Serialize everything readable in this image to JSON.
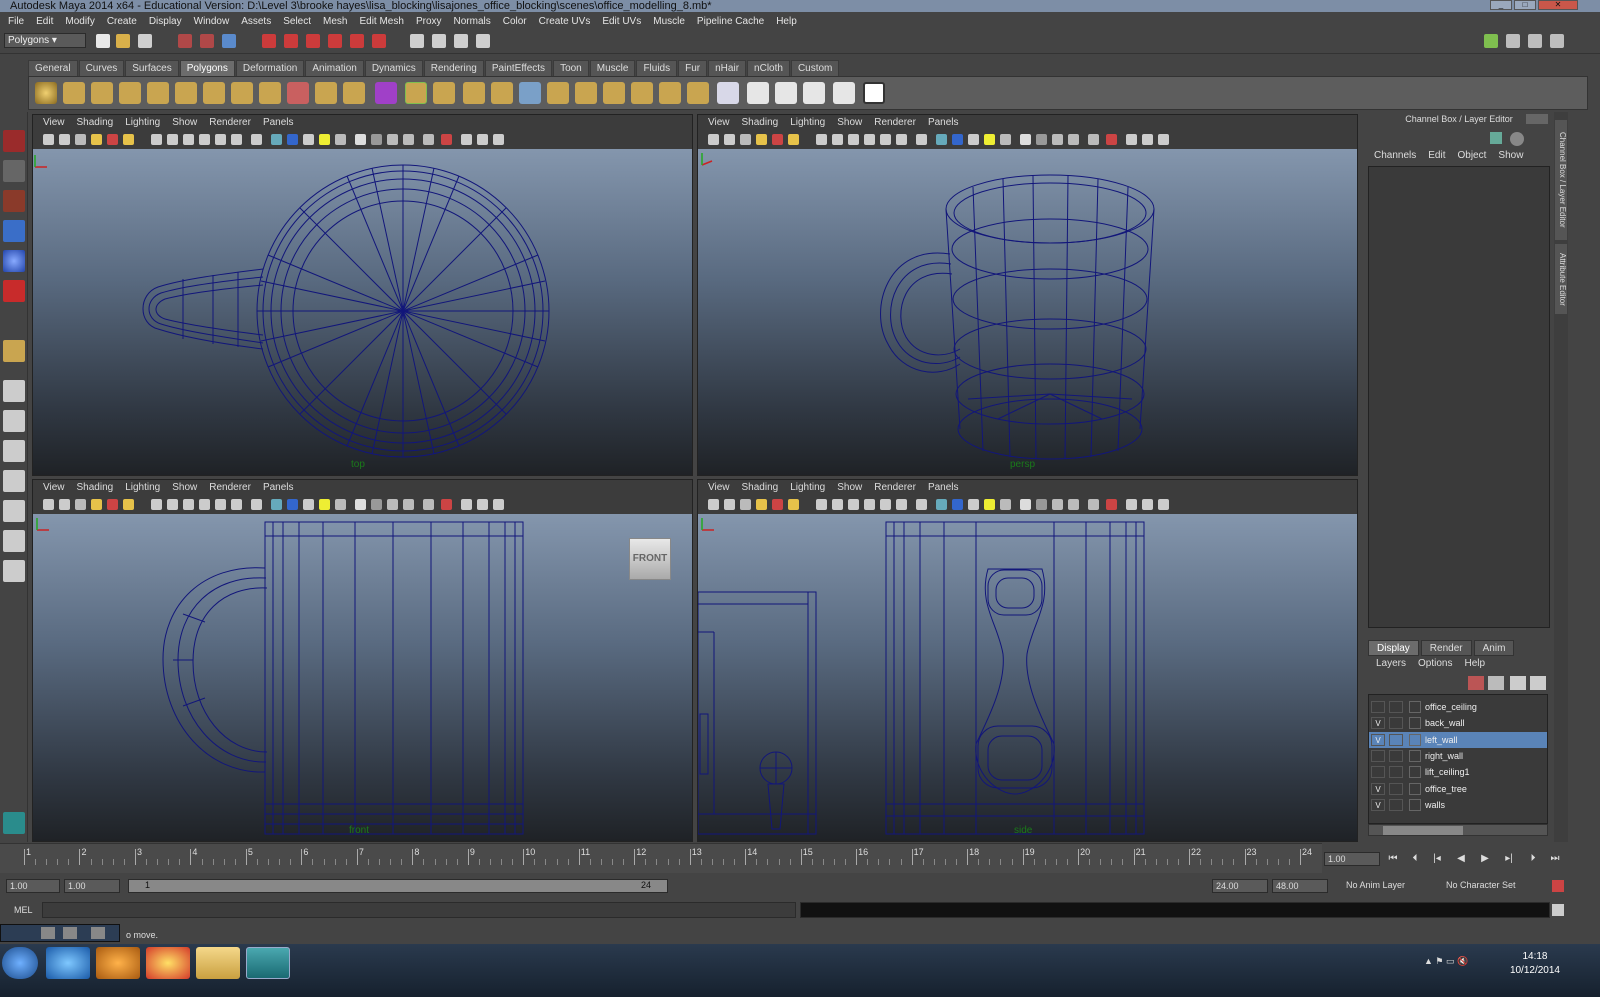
{
  "window": {
    "title": "Autodesk Maya 2014 x64 - Educational Version: D:\\Level 3\\brooke hayes\\lisa_blocking\\lisajones_office_blocking\\scenes\\office_modelling_8.mb*"
  },
  "menubar": [
    "File",
    "Edit",
    "Modify",
    "Create",
    "Display",
    "Window",
    "Assets",
    "Select",
    "Mesh",
    "Edit Mesh",
    "Proxy",
    "Normals",
    "Color",
    "Create UVs",
    "Edit UVs",
    "Muscle",
    "Pipeline Cache",
    "Help"
  ],
  "toolbar": {
    "mode_selector": "Polygons"
  },
  "shelf_tabs": [
    "General",
    "Curves",
    "Surfaces",
    "Polygons",
    "Deformation",
    "Animation",
    "Dynamics",
    "Rendering",
    "PaintEffects",
    "Toon",
    "Muscle",
    "Fluids",
    "Fur",
    "nHair",
    "nCloth",
    "Custom"
  ],
  "active_shelf": "Polygons",
  "viewport_menu": [
    "View",
    "Shading",
    "Lighting",
    "Show",
    "Renderer",
    "Panels"
  ],
  "viewports": [
    {
      "camera": "top"
    },
    {
      "camera": "persp"
    },
    {
      "camera": "front",
      "view_cube": "FRONT"
    },
    {
      "camera": "side"
    }
  ],
  "channel_box": {
    "title": "Channel Box / Layer Editor",
    "menu": [
      "Channels",
      "Edit",
      "Object",
      "Show"
    ]
  },
  "layer_editor": {
    "tabs": [
      "Display",
      "Render",
      "Anim"
    ],
    "active_tab": "Display",
    "menu": [
      "Layers",
      "Options",
      "Help"
    ],
    "layers": [
      {
        "visible": "",
        "name": "office_ceiling",
        "selected": false
      },
      {
        "visible": "V",
        "name": "back_wall",
        "selected": false
      },
      {
        "visible": "V",
        "name": "left_wall",
        "selected": true
      },
      {
        "visible": "",
        "name": "right_wall",
        "selected": false
      },
      {
        "visible": "",
        "name": "lift_ceiling1",
        "selected": false
      },
      {
        "visible": "V",
        "name": "office_tree",
        "selected": false
      },
      {
        "visible": "V",
        "name": "walls",
        "selected": false
      }
    ]
  },
  "side_tabs": [
    "Channel Box / Layer Editor",
    "Attribute Editor"
  ],
  "timeline": {
    "ticks": [
      "1",
      "2",
      "3",
      "4",
      "5",
      "6",
      "7",
      "8",
      "9",
      "10",
      "11",
      "12",
      "13",
      "14",
      "15",
      "16",
      "17",
      "18",
      "19",
      "20",
      "21",
      "22",
      "23",
      "24"
    ],
    "current_time": "1.00"
  },
  "range": {
    "start": "1.00",
    "playback_start": "1.00",
    "slider_start": "1",
    "slider_end": "24",
    "playback_end": "24.00",
    "end": "48.00",
    "anim_layer": "No Anim Layer",
    "character_set": "No Character Set"
  },
  "command_line": {
    "label": "MEL"
  },
  "help_line": {
    "text": "o move."
  },
  "taskbar": {
    "time": "14:18",
    "date": "10/12/2014"
  },
  "colors": {
    "wire": "#12167a",
    "selected_layer": "#5a84b8",
    "panel_bg": "#444444"
  }
}
